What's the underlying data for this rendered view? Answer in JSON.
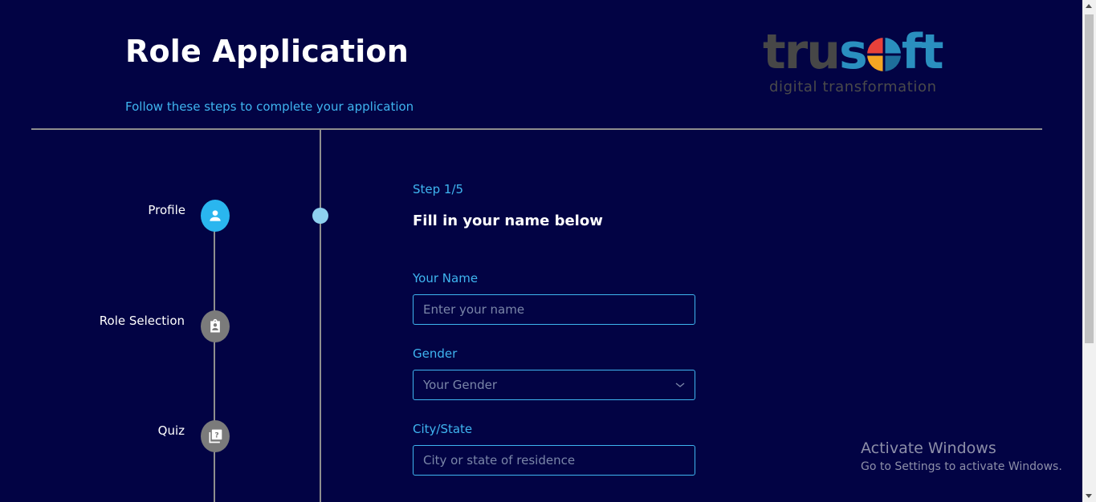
{
  "header": {
    "title": "Role Application",
    "subtitle": "Follow these steps to complete your application"
  },
  "logo": {
    "word_part1": "tru",
    "word_part2": "s",
    "word_part3": "ft",
    "tagline": "digital transformation",
    "mark_colors": [
      "#e8413a",
      "#2a8fbf",
      "#f4a623",
      "#1e6e9b"
    ]
  },
  "stepper": {
    "steps": [
      {
        "label": "Profile",
        "icon": "person-icon",
        "state": "active"
      },
      {
        "label": "Role Selection",
        "icon": "clipboard-person-icon",
        "state": "inactive"
      },
      {
        "label": "Quiz",
        "icon": "quiz-icon",
        "state": "inactive"
      }
    ]
  },
  "form": {
    "step_indicator": "Step 1/5",
    "heading": "Fill in your name below",
    "fields": {
      "name": {
        "label": "Your Name",
        "placeholder": "Enter your name"
      },
      "gender": {
        "label": "Gender",
        "placeholder": "Your Gender"
      },
      "city": {
        "label": "City/State",
        "placeholder": "City or state of residence"
      }
    }
  },
  "watermark": {
    "title": "Activate Windows",
    "subtitle": "Go to Settings to activate Windows."
  },
  "colors": {
    "background": "#020344",
    "accent": "#3fb5f0",
    "active_step": "#2ab6ef",
    "inactive_step": "#7b7b7b"
  }
}
